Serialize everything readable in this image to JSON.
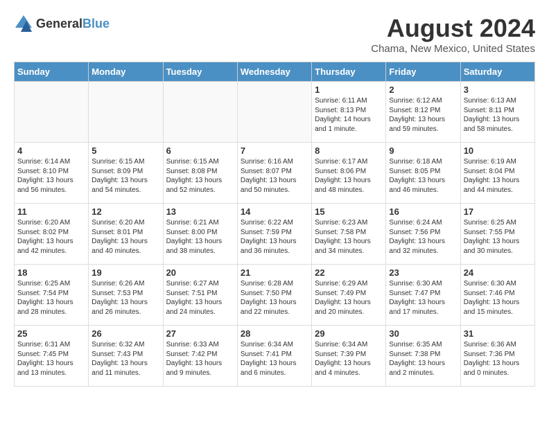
{
  "header": {
    "logo_general": "General",
    "logo_blue": "Blue",
    "title": "August 2024",
    "location": "Chama, New Mexico, United States"
  },
  "days_of_week": [
    "Sunday",
    "Monday",
    "Tuesday",
    "Wednesday",
    "Thursday",
    "Friday",
    "Saturday"
  ],
  "weeks": [
    [
      {
        "day": "",
        "info": ""
      },
      {
        "day": "",
        "info": ""
      },
      {
        "day": "",
        "info": ""
      },
      {
        "day": "",
        "info": ""
      },
      {
        "day": "1",
        "info": "Sunrise: 6:11 AM\nSunset: 8:13 PM\nDaylight: 14 hours\nand 1 minute."
      },
      {
        "day": "2",
        "info": "Sunrise: 6:12 AM\nSunset: 8:12 PM\nDaylight: 13 hours\nand 59 minutes."
      },
      {
        "day": "3",
        "info": "Sunrise: 6:13 AM\nSunset: 8:11 PM\nDaylight: 13 hours\nand 58 minutes."
      }
    ],
    [
      {
        "day": "4",
        "info": "Sunrise: 6:14 AM\nSunset: 8:10 PM\nDaylight: 13 hours\nand 56 minutes."
      },
      {
        "day": "5",
        "info": "Sunrise: 6:15 AM\nSunset: 8:09 PM\nDaylight: 13 hours\nand 54 minutes."
      },
      {
        "day": "6",
        "info": "Sunrise: 6:15 AM\nSunset: 8:08 PM\nDaylight: 13 hours\nand 52 minutes."
      },
      {
        "day": "7",
        "info": "Sunrise: 6:16 AM\nSunset: 8:07 PM\nDaylight: 13 hours\nand 50 minutes."
      },
      {
        "day": "8",
        "info": "Sunrise: 6:17 AM\nSunset: 8:06 PM\nDaylight: 13 hours\nand 48 minutes."
      },
      {
        "day": "9",
        "info": "Sunrise: 6:18 AM\nSunset: 8:05 PM\nDaylight: 13 hours\nand 46 minutes."
      },
      {
        "day": "10",
        "info": "Sunrise: 6:19 AM\nSunset: 8:04 PM\nDaylight: 13 hours\nand 44 minutes."
      }
    ],
    [
      {
        "day": "11",
        "info": "Sunrise: 6:20 AM\nSunset: 8:02 PM\nDaylight: 13 hours\nand 42 minutes."
      },
      {
        "day": "12",
        "info": "Sunrise: 6:20 AM\nSunset: 8:01 PM\nDaylight: 13 hours\nand 40 minutes."
      },
      {
        "day": "13",
        "info": "Sunrise: 6:21 AM\nSunset: 8:00 PM\nDaylight: 13 hours\nand 38 minutes."
      },
      {
        "day": "14",
        "info": "Sunrise: 6:22 AM\nSunset: 7:59 PM\nDaylight: 13 hours\nand 36 minutes."
      },
      {
        "day": "15",
        "info": "Sunrise: 6:23 AM\nSunset: 7:58 PM\nDaylight: 13 hours\nand 34 minutes."
      },
      {
        "day": "16",
        "info": "Sunrise: 6:24 AM\nSunset: 7:56 PM\nDaylight: 13 hours\nand 32 minutes."
      },
      {
        "day": "17",
        "info": "Sunrise: 6:25 AM\nSunset: 7:55 PM\nDaylight: 13 hours\nand 30 minutes."
      }
    ],
    [
      {
        "day": "18",
        "info": "Sunrise: 6:25 AM\nSunset: 7:54 PM\nDaylight: 13 hours\nand 28 minutes."
      },
      {
        "day": "19",
        "info": "Sunrise: 6:26 AM\nSunset: 7:53 PM\nDaylight: 13 hours\nand 26 minutes."
      },
      {
        "day": "20",
        "info": "Sunrise: 6:27 AM\nSunset: 7:51 PM\nDaylight: 13 hours\nand 24 minutes."
      },
      {
        "day": "21",
        "info": "Sunrise: 6:28 AM\nSunset: 7:50 PM\nDaylight: 13 hours\nand 22 minutes."
      },
      {
        "day": "22",
        "info": "Sunrise: 6:29 AM\nSunset: 7:49 PM\nDaylight: 13 hours\nand 20 minutes."
      },
      {
        "day": "23",
        "info": "Sunrise: 6:30 AM\nSunset: 7:47 PM\nDaylight: 13 hours\nand 17 minutes."
      },
      {
        "day": "24",
        "info": "Sunrise: 6:30 AM\nSunset: 7:46 PM\nDaylight: 13 hours\nand 15 minutes."
      }
    ],
    [
      {
        "day": "25",
        "info": "Sunrise: 6:31 AM\nSunset: 7:45 PM\nDaylight: 13 hours\nand 13 minutes."
      },
      {
        "day": "26",
        "info": "Sunrise: 6:32 AM\nSunset: 7:43 PM\nDaylight: 13 hours\nand 11 minutes."
      },
      {
        "day": "27",
        "info": "Sunrise: 6:33 AM\nSunset: 7:42 PM\nDaylight: 13 hours\nand 9 minutes."
      },
      {
        "day": "28",
        "info": "Sunrise: 6:34 AM\nSunset: 7:41 PM\nDaylight: 13 hours\nand 6 minutes."
      },
      {
        "day": "29",
        "info": "Sunrise: 6:34 AM\nSunset: 7:39 PM\nDaylight: 13 hours\nand 4 minutes."
      },
      {
        "day": "30",
        "info": "Sunrise: 6:35 AM\nSunset: 7:38 PM\nDaylight: 13 hours\nand 2 minutes."
      },
      {
        "day": "31",
        "info": "Sunrise: 6:36 AM\nSunset: 7:36 PM\nDaylight: 13 hours\nand 0 minutes."
      }
    ]
  ]
}
